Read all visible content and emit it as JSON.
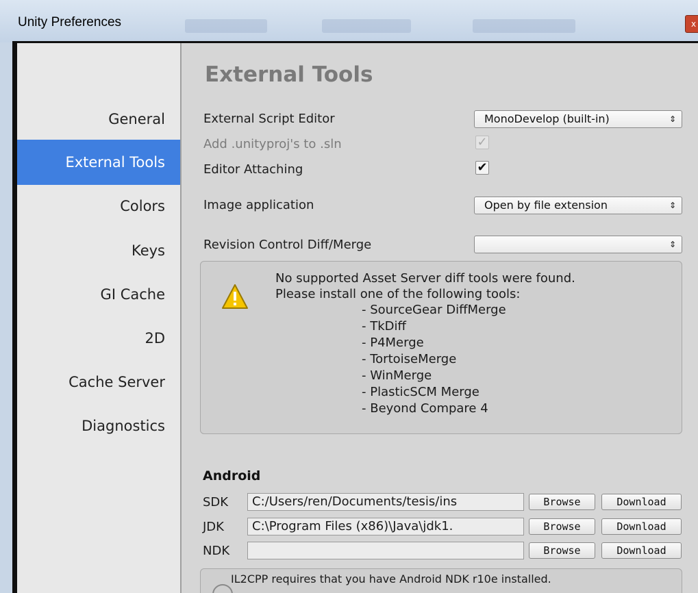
{
  "window": {
    "title": "Unity Preferences",
    "close_label": "x"
  },
  "sidebar": {
    "items": [
      {
        "label": "General"
      },
      {
        "label": "External Tools"
      },
      {
        "label": "Colors"
      },
      {
        "label": "Keys"
      },
      {
        "label": "GI Cache"
      },
      {
        "label": "2D"
      },
      {
        "label": "Cache Server"
      },
      {
        "label": "Diagnostics"
      }
    ],
    "active": "External Tools"
  },
  "main": {
    "heading": "External Tools",
    "external_script_editor": {
      "label": "External Script Editor",
      "value": "MonoDevelop (built-in)"
    },
    "add_unityproj": {
      "label": "Add .unityproj's to .sln",
      "checked": true,
      "enabled": false
    },
    "editor_attaching": {
      "label": "Editor Attaching",
      "checked": true
    },
    "image_application": {
      "label": "Image application",
      "value": "Open by file extension"
    },
    "revision_control": {
      "label": "Revision Control Diff/Merge",
      "value": ""
    },
    "diff_help": {
      "line1": "No supported Asset Server diff tools were found.",
      "line2": "Please install one of the following tools:",
      "tools": [
        "- SourceGear DiffMerge",
        "- TkDiff",
        "- P4Merge",
        "- TortoiseMerge",
        "- WinMerge",
        "- PlasticSCM Merge",
        "- Beyond Compare 4"
      ]
    },
    "android": {
      "title": "Android",
      "browse_label": "Browse",
      "download_label": "Download",
      "paths": [
        {
          "label": "SDK",
          "value": "C:/Users/ren/Documents/tesis/ins"
        },
        {
          "label": "JDK",
          "value": "C:\\Program Files (x86)\\Java\\jdk1."
        },
        {
          "label": "NDK",
          "value": ""
        }
      ],
      "note": "IL2CPP requires that you have Android NDK r10e installed."
    }
  },
  "icons": {
    "warning": "warning-icon",
    "info": "info-icon",
    "dropdown_arrow": "dropdown-arrow-icon",
    "checkmark": "checkmark-icon"
  }
}
